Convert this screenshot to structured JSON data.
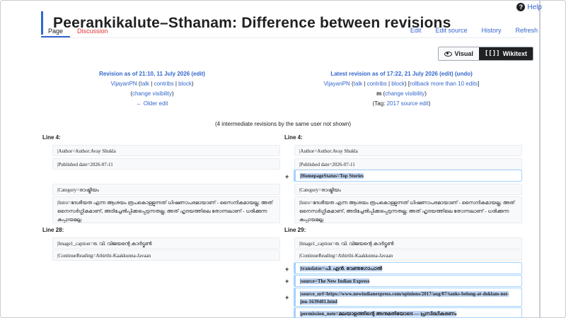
{
  "page": {
    "title": "Peerankikalute–Sthanam: Difference between revisions",
    "help_label": "Help"
  },
  "tabs": {
    "page": "Page",
    "discussion": "Discussion",
    "edit": "Edit",
    "edit_source": "Edit source",
    "history": "History",
    "refresh": "Refresh"
  },
  "view_toggle": {
    "visual": "Visual",
    "wikitext": "Wikitext",
    "wikitext_icon": "[[]]"
  },
  "left_rev": {
    "title": "Revision as of 21:10, 11 July 2026",
    "edit": "(edit)",
    "user": "VijayanPN",
    "talk": "talk",
    "contribs": "contribs",
    "block": "block",
    "change_visibility": "change visibility",
    "older_edit": "← Older edit"
  },
  "right_rev": {
    "title": "Latest revision as of 17:22, 21 July 2026",
    "edit": "(edit)",
    "undo": "(undo)",
    "user": "VijayanPN",
    "talk": "talk",
    "contribs": "contribs",
    "block": "block",
    "rollback": "rollback more than 10 edits",
    "minor": "m",
    "change_visibility": "change visibility",
    "tag_prefix": "(Tag: ",
    "tag_link": "2017 source edit",
    "tag_suffix": ")"
  },
  "intermediate": "(4 intermediate revisions by the same user not shown)",
  "diff": {
    "line_4_left": "Line 4:",
    "line_4_right": "Line 4:",
    "line_28": "Line 28:",
    "line_29": "Line 29:",
    "author": "|Author=Author:Avay Shukla",
    "published": "|Published date=2026-07-11",
    "homepage": "|HomepageStatus=Top Stories",
    "category": "|Category=രാഷ്ട്രീയം",
    "intro": "|Intro=ദേശീയത എന്ന ആശയം രൂപകൊള്ളുന്നത് ധിഷണാപരമായാണ് - സൈനികമായല്ല; അത് നൈസർഗ്ഗികമാണ്, അടിച്ചേൽപ്പിക്കപ്പെടുന്നതല്ല; അത് ഹൃദയത്തിലെ തോന്നലാണ് - ധരിക്കുന്ന കുപ്പായമല്ല",
    "caption": "|Image1_caption=ഒ. വി. വിജയന്റെ കാർട്ടൂൺ",
    "continue": "|ContinueReading=Athirthi-Kaakkunna-Javaan",
    "translator": "|translator=പി. എൻ. വേണുഗോപാൽ",
    "source": "|source=The New Indian Express",
    "source_url": "|source_url=https://www.newindianexpress.com/opinions/2017/aug/07/tanks-belong-at-doklam-not-jnu-1639401.html",
    "permission": "|permission_note=മലയാളത്തിന്റെ അനുമതിയോടെ — പ്രസിദ്ധീകരണം",
    "plus": "+"
  }
}
